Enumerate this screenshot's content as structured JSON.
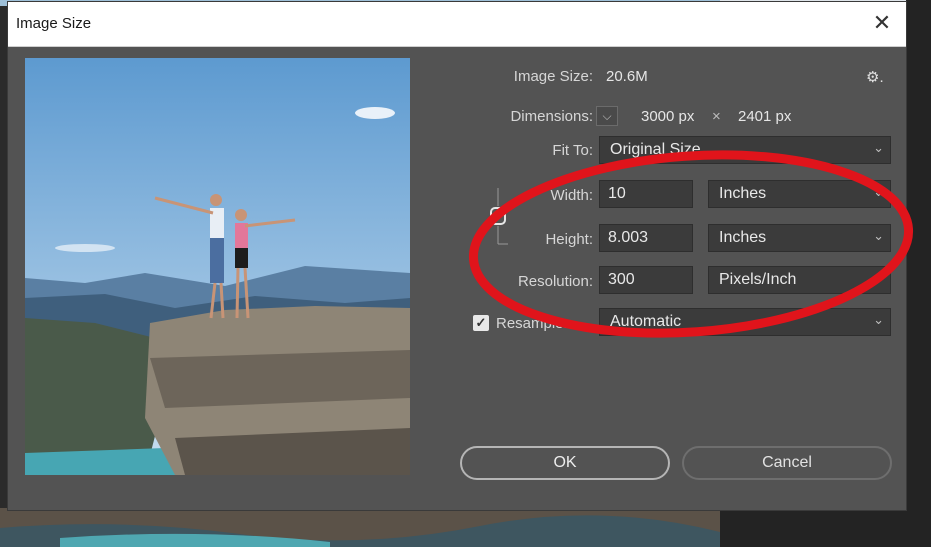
{
  "window": {
    "title": "Image Size",
    "close_glyph": "✕"
  },
  "info": {
    "image_size_label": "Image Size:",
    "image_size_value": "20.6M",
    "dimensions_label": "Dimensions:",
    "dimensions_width": "3000 px",
    "dimensions_sep": "×",
    "dimensions_height": "2401 px",
    "gear_glyph": "⚙."
  },
  "fit_to": {
    "label": "Fit To:",
    "value": "Original Size"
  },
  "width": {
    "label": "Width:",
    "value": "10",
    "unit": "Inches"
  },
  "height": {
    "label": "Height:",
    "value": "8.003",
    "unit": "Inches"
  },
  "resolution": {
    "label": "Resolution:",
    "value": "300",
    "unit": "Pixels/Inch"
  },
  "resample": {
    "label": "Resample:",
    "checked": true,
    "value": "Automatic"
  },
  "buttons": {
    "ok": "OK",
    "cancel": "Cancel"
  },
  "colors": {
    "annotation": "#e0141b",
    "dialog_bg": "#535353",
    "field_bg": "#3b3b3b"
  },
  "icons": {
    "gear": "gear-icon",
    "close": "close-icon",
    "chain": "link-chain-icon",
    "chevron": "chevron-down-icon"
  }
}
